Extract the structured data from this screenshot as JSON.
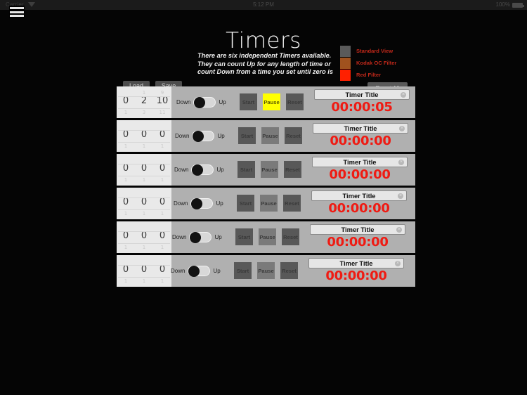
{
  "status_bar": {
    "carrier": "Carrier",
    "time": "5:12 PM",
    "battery_percent": "100%",
    "wifi_icon": "wifi-icon",
    "battery_icon": "battery-icon"
  },
  "menu_icon": "hamburger-menu-icon",
  "header": {
    "title": "Timers",
    "subtitle_line1": "There are six independent Timers available.",
    "subtitle_line2": "They can count Up for any length of time or",
    "subtitle_line3": "count Down from a time you set until zero is"
  },
  "legend": [
    {
      "label": "Standard View",
      "color": "#5a5a5a"
    },
    {
      "label": "Kodak OC Filter",
      "color": "#a0521e"
    },
    {
      "label": "Red Filter",
      "color": "#ff2000"
    }
  ],
  "toolbar": {
    "load_label": "Load",
    "save_label": "Save",
    "reset_all_label": "Reset All"
  },
  "row_common": {
    "down_label": "Down",
    "up_label": "Up",
    "start_label": "Start",
    "pause_label": "Pause",
    "reset_label": "Reset",
    "title_placeholder": "Timer Title",
    "clear_icon": "clear-text-icon"
  },
  "timers": [
    {
      "index": 1,
      "picker": [
        {
          "prev": "",
          "current": "0",
          "next": "1"
        },
        {
          "prev": "1",
          "current": "2",
          "next": "3"
        },
        {
          "prev": "9",
          "current": "10",
          "next": "11"
        }
      ],
      "direction": "Down",
      "title": "Timer Title",
      "clock": "00:00:05",
      "paused": true,
      "offset": 0
    },
    {
      "index": 2,
      "picker": [
        {
          "prev": "",
          "current": "0",
          "next": "1"
        },
        {
          "prev": "",
          "current": "0",
          "next": "1"
        },
        {
          "prev": "",
          "current": "0",
          "next": "1"
        }
      ],
      "direction": "Down",
      "title": "Timer Title",
      "clock": "00:00:00",
      "paused": false,
      "offset": -2
    },
    {
      "index": 3,
      "picker": [
        {
          "prev": "",
          "current": "0",
          "next": "1"
        },
        {
          "prev": "",
          "current": "0",
          "next": "1"
        },
        {
          "prev": "",
          "current": "0",
          "next": "1"
        }
      ],
      "direction": "Down",
      "title": "Timer Title",
      "clock": "00:00:00",
      "paused": false,
      "offset": -3
    },
    {
      "index": 4,
      "picker": [
        {
          "prev": "",
          "current": "0",
          "next": "1"
        },
        {
          "prev": "",
          "current": "0",
          "next": "1"
        },
        {
          "prev": "",
          "current": "0",
          "next": "1"
        }
      ],
      "direction": "Down",
      "title": "Timer Title",
      "clock": "00:00:00",
      "paused": false,
      "offset": -4
    },
    {
      "index": 5,
      "picker": [
        {
          "prev": "",
          "current": "0",
          "next": "1"
        },
        {
          "prev": "",
          "current": "0",
          "next": "1"
        },
        {
          "prev": "",
          "current": "0",
          "next": "1"
        }
      ],
      "direction": "Down",
      "title": "Timer Title",
      "clock": "00:00:00",
      "paused": false,
      "offset": -6
    },
    {
      "index": 6,
      "picker": [
        {
          "prev": "",
          "current": "0",
          "next": "1"
        },
        {
          "prev": "",
          "current": "0",
          "next": "1"
        },
        {
          "prev": "",
          "current": "0",
          "next": "1"
        }
      ],
      "direction": "Down",
      "title": "Timer Title",
      "clock": "00:00:00",
      "paused": false,
      "offset": -8
    }
  ]
}
